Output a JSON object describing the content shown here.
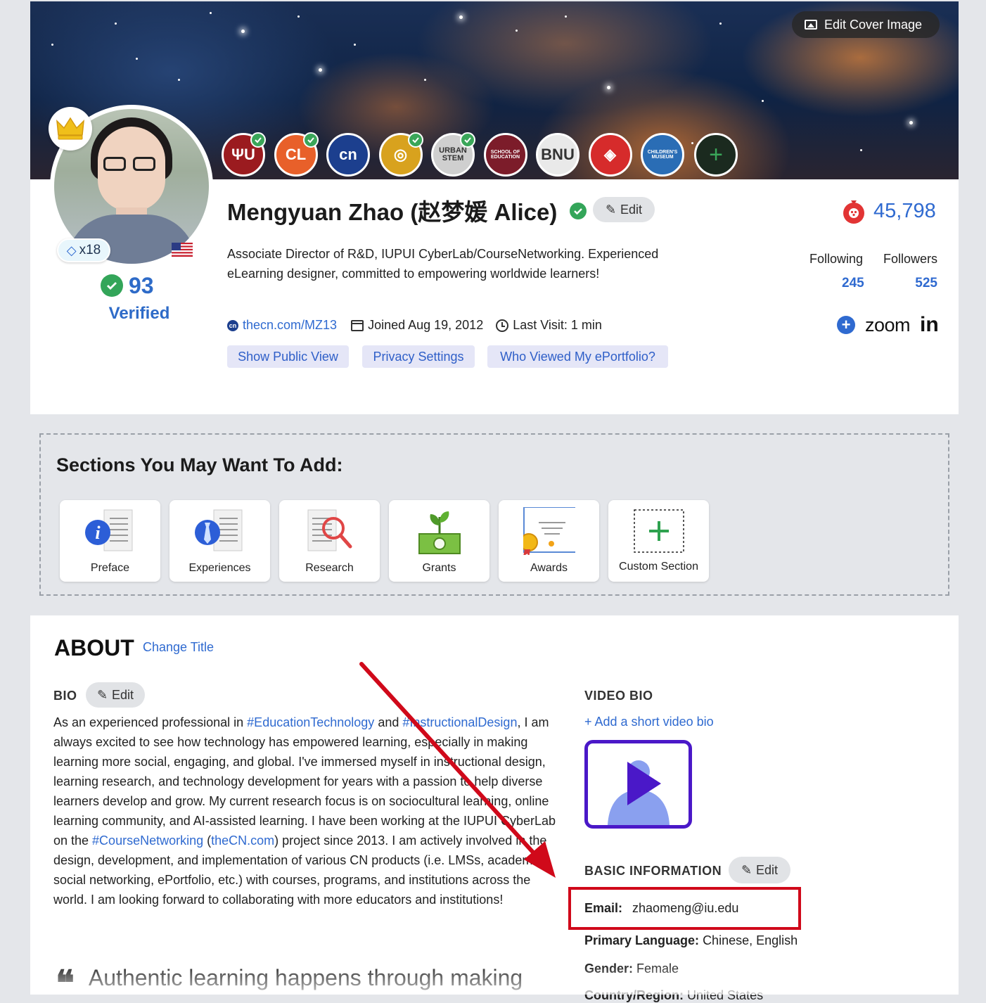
{
  "cover": {
    "edit_label": "Edit Cover Image"
  },
  "profile": {
    "name": "Mengyuan Zhao (赵梦媛 Alice)",
    "edit_label": "Edit",
    "badge_count": "x18",
    "verify_count": "93",
    "verified_label": "Verified",
    "points": "45,798",
    "tagline": "Associate Director of R&D, IUPUI CyberLab/CourseNetworking. Experienced eLearning designer, committed to empowering worldwide learners!",
    "following_label": "Following",
    "followers_label": "Followers",
    "following_count": "245",
    "followers_count": "525",
    "url": "thecn.com/MZ13",
    "joined": "Joined Aug 19, 2012",
    "last_visit": "Last Visit: 1 min",
    "zoom_label": "zoom",
    "linkedin_label": "in"
  },
  "institutions": [
    {
      "name": "indiana-university-logo",
      "color": "#9b1b1f",
      "text": "ΨU",
      "verified": true
    },
    {
      "name": "cl-logo",
      "color": "#e8602a",
      "text": "CL",
      "verified": true
    },
    {
      "name": "cn-logo",
      "color": "#1c3f8e",
      "text": "cn",
      "verified": false
    },
    {
      "name": "indiana-state-logo",
      "color": "#d8a21e",
      "text": "◎",
      "verified": true
    },
    {
      "name": "urban-stem-logo",
      "color": "#cfcfcf",
      "text": "URBAN STEM",
      "verified": true
    },
    {
      "name": "school-of-education-logo",
      "color": "#7c1c2a",
      "text": "SCHOOL OF EDUCATION",
      "verified": false
    },
    {
      "name": "beijing-normal-logo",
      "color": "#e9e9e9",
      "text": "BNU",
      "verified": false
    },
    {
      "name": "red-diamond-logo",
      "color": "#d62b2b",
      "text": "◈",
      "verified": false
    },
    {
      "name": "childrens-museum-logo",
      "color": "#2a6db5",
      "text": "CHILDREN'S MUSEUM",
      "verified": false
    }
  ],
  "actions": {
    "public_view": "Show Public View",
    "privacy": "Privacy Settings",
    "who_viewed": "Who Viewed My ePortfolio?"
  },
  "sections": {
    "title": "Sections You May Want To Add:",
    "items": [
      {
        "label": "Preface",
        "icon": "preface-icon"
      },
      {
        "label": "Experiences",
        "icon": "experiences-icon"
      },
      {
        "label": "Research",
        "icon": "research-icon"
      },
      {
        "label": "Grants",
        "icon": "grants-icon"
      },
      {
        "label": "Awards",
        "icon": "awards-icon"
      },
      {
        "label": "Custom Section",
        "icon": "custom-section-icon"
      }
    ]
  },
  "about": {
    "title": "ABOUT",
    "change_title": "Change Title",
    "bio_label": "BIO",
    "edit_label": "Edit",
    "bio": {
      "p1": "As an experienced professional in ",
      "tag1": "#EducationTechnology",
      "p2": " and ",
      "tag2": "#InstructionalDesign",
      "p3": ", I am always excited to see how technology has empowered learning, especially in making learning more social, engaging, and global. I've immersed myself in instructional design, learning research, and technology development for years with a passion to help diverse learners develop and grow. My current research focus is on sociocultural learning, online learning community, and AI-assisted learning. I have been working at the IUPUI CyberLab on the ",
      "tag3": "#CourseNetworking",
      "p4": " (",
      "tag4": "theCN.com",
      "p5": ") project since 2013. I am actively involved in the design, development, and implementation of various CN products (i.e. LMSs, academic social networking, ePortfolio, etc.) with courses, programs, and institutions across the world. I am looking forward to collaborating with more educators and institutions!"
    },
    "quote": "Authentic learning happens through making",
    "video_label": "VIDEO BIO",
    "add_video": "+ Add a short video bio",
    "basic_label": "BASIC INFORMATION",
    "email_label": "Email:",
    "email": "zhaomeng@iu.edu",
    "lang_label": "Primary Language:",
    "lang": "Chinese, English",
    "gender_label": "Gender:",
    "gender": "Female",
    "country_label": "Country/Region:",
    "country": "United States"
  },
  "colors": {
    "accent": "#2f6ad0",
    "verified": "#33a559",
    "highlight": "#d0091a"
  }
}
